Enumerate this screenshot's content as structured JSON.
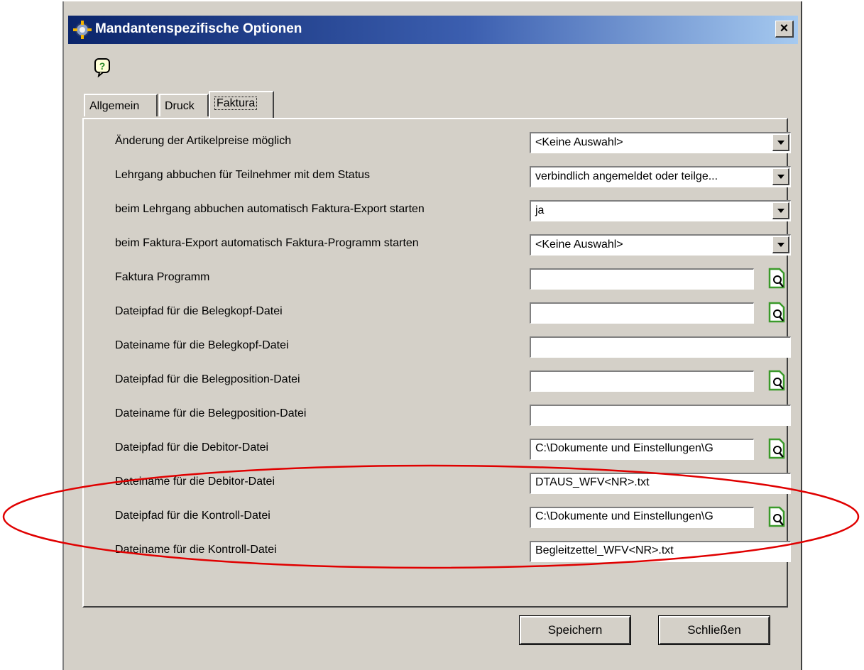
{
  "window": {
    "title": "Mandantenspezifische Optionen"
  },
  "tabs": [
    {
      "label": "Allgemein"
    },
    {
      "label": "Druck"
    },
    {
      "label": "Faktura"
    }
  ],
  "rows": {
    "r0": {
      "label": "Änderung der Artikelpreise möglich",
      "value": "<Keine Auswahl>"
    },
    "r1": {
      "label": "Lehrgang abbuchen für Teilnehmer mit dem Status",
      "value": "verbindlich angemeldet oder teilge..."
    },
    "r2": {
      "label": "beim Lehrgang abbuchen automatisch Faktura-Export starten",
      "value": "ja"
    },
    "r3": {
      "label": "beim Faktura-Export automatisch Faktura-Programm starten",
      "value": "<Keine Auswahl>"
    },
    "r4": {
      "label": "Faktura Programm",
      "value": ""
    },
    "r5": {
      "label": "Dateipfad für die Belegkopf-Datei",
      "value": ""
    },
    "r6": {
      "label": "Dateiname für die Belegkopf-Datei",
      "value": ""
    },
    "r7": {
      "label": "Dateipfad für die Belegposition-Datei",
      "value": ""
    },
    "r8": {
      "label": "Dateiname für die Belegposition-Datei",
      "value": ""
    },
    "r9": {
      "label": "Dateipfad für die Debitor-Datei",
      "value": "C:\\Dokumente und Einstellungen\\G"
    },
    "r10": {
      "label": "Dateiname für die Debitor-Datei",
      "value": "DTAUS_WFV<NR>.txt"
    },
    "r11": {
      "label": "Dateipfad für die Kontroll-Datei",
      "value": "C:\\Dokumente und Einstellungen\\G"
    },
    "r12": {
      "label": "Dateiname für die Kontroll-Datei",
      "value": "Begleitzettel_WFV<NR>.txt"
    }
  },
  "buttons": {
    "save": "Speichern",
    "close": "Schließen"
  },
  "icons": {
    "app": "gear-icon",
    "close": "close-icon",
    "help": "help-icon",
    "browse": "file-search-icon",
    "dropdown": "chevron-down-icon"
  },
  "colors": {
    "titlebar_start": "#0a246a",
    "titlebar_end": "#a6caf0",
    "dialog_bg": "#d4d0c8",
    "annotation": "#e00000",
    "browse_icon": "#3a9a2a"
  }
}
